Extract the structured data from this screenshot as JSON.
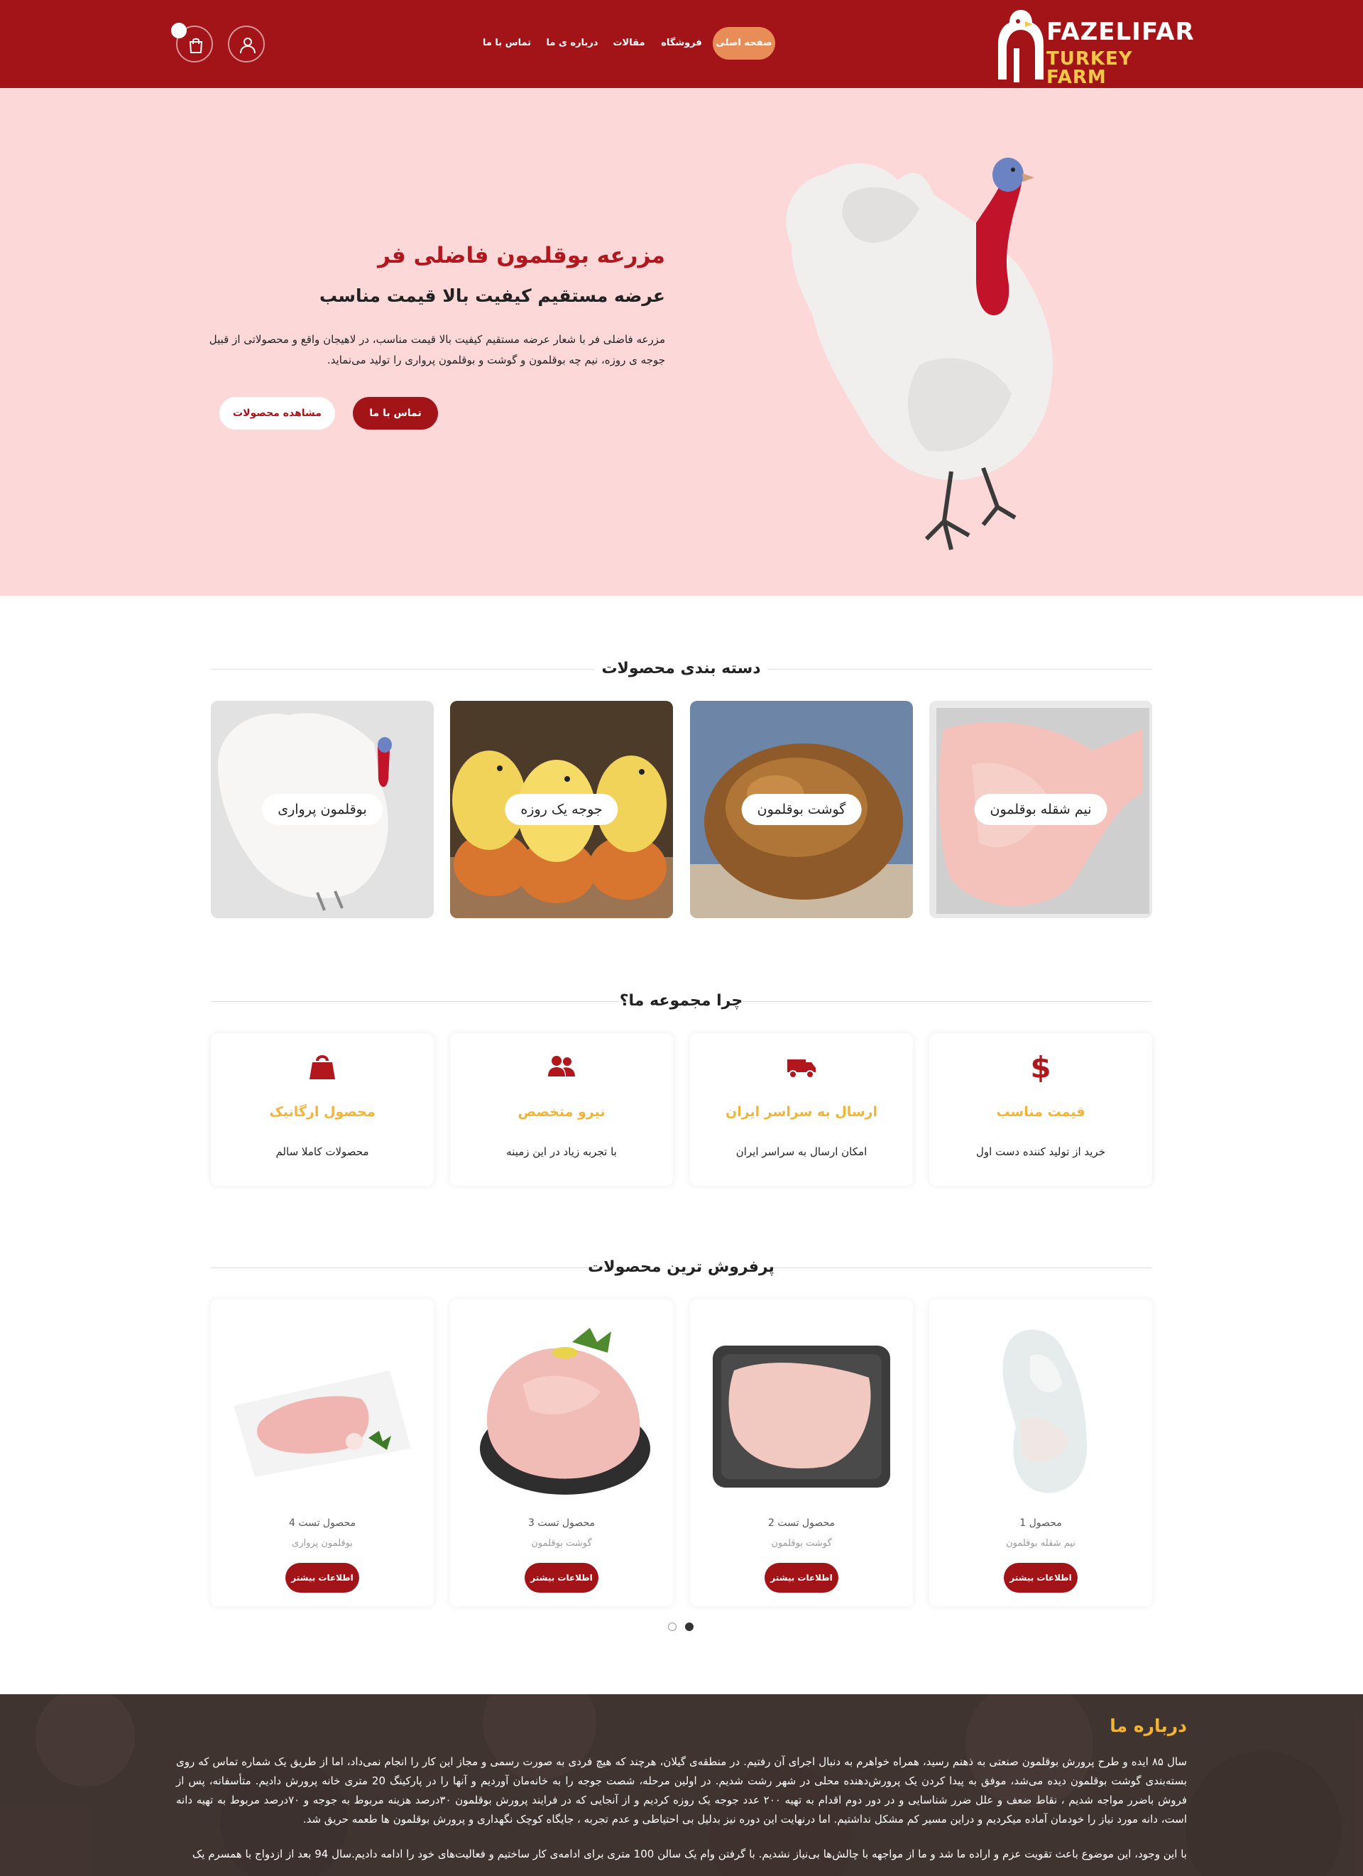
{
  "header": {
    "logo": {
      "line1": "FAZELIFAR",
      "line2": "TURKEY FARM"
    },
    "nav": [
      {
        "label": "صفحه اصلی",
        "active": true
      },
      {
        "label": "فروشگاه",
        "active": false
      },
      {
        "label": "مقالات",
        "active": false
      },
      {
        "label": "درباره ی ما",
        "active": false
      },
      {
        "label": "تماس با ما",
        "active": false
      }
    ],
    "icons": [
      "user-icon",
      "cart-icon"
    ]
  },
  "hero": {
    "title": "مزرعه بوقلمون فاضلی فر",
    "subtitle": "عرضه مستقیم کیفیت بالا قیمت مناسب",
    "description": "مزرعه فاضلی فر با شعار عرضه مستقیم کیفیت بالا قیمت مناسب، در لاهیجان واقع و محصولاتی از قبیل جوجه ی روزه، نیم چه بوقلمون و گوشت و بوقلمون پرواری را تولید می‌نماید.",
    "primary_button": "تماس با ما",
    "secondary_button": "مشاهده محصولات"
  },
  "categories": {
    "title": "دسته بندی محصولات",
    "items": [
      {
        "label": "نیم شقله بوقلمون"
      },
      {
        "label": "گوشت بوقلمون"
      },
      {
        "label": "جوجه یک روزه"
      },
      {
        "label": "بوقلمون پرواری"
      }
    ]
  },
  "features": {
    "title": "چرا مجموعه ما؟",
    "items": [
      {
        "icon": "dollar-icon",
        "title": "قیمت مناسب",
        "desc": "خرید از تولید کننده دست اول"
      },
      {
        "icon": "truck-icon",
        "title": "ارسال به سراسر ایران",
        "desc": "امکان ارسال به سراسر ایران"
      },
      {
        "icon": "users-icon",
        "title": "نیرو متخصص",
        "desc": "با تجربه زیاد در این زمینه"
      },
      {
        "icon": "bag-icon",
        "title": "محصول ارگانیک",
        "desc": "محصولات کاملا سالم"
      }
    ]
  },
  "products": {
    "title": "پرفروش ترین محصولات",
    "button_label": "اطلاعات بیشتر",
    "items": [
      {
        "name": "محصول 1",
        "category": "نیم شقله بوقلمون"
      },
      {
        "name": "محصول تست 2",
        "category": "گوشت بوقلمون"
      },
      {
        "name": "محصول تست 3",
        "category": "گوشت بوقلمون"
      },
      {
        "name": "محصول تست 4",
        "category": "بوقلمون پرواری"
      }
    ],
    "carousel_pages": 2,
    "carousel_active": 1
  },
  "about": {
    "title": "درباره ما",
    "paragraph1": "سال ۸۵ ایده و طرح پرورش بوقلمون صنعتی به ذهنم رسید، همراه خواهرم به دنبال اجرای آن رفتیم. در منطقه‌ی گیلان، هرچند که هیچ فردی به صورت رسمی و مجاز این کار را انجام نمی‌داد، اما از طریق یک شماره تماس که روی بسته‌بندی گوشت بوقلمون دیده می‌شد، موفق به پیدا کردن یک پرورش‌دهنده محلی در شهر رشت شدیم. در اولین مرحله، شصت جوجه را به خانه‌مان آوردیم و آنها را در پارکینگ 20 متری خانه پرورش دادیم. متأسفانه، پس از فروش باضرر مواجه شدیم ، نقاط ضعف و علل ضرر شناسایی و در دور دوم اقدام به تهیه ۲۰۰ عدد جوجه یک روزه کردیم و از آنجایی که در فرایند پرورش بوقلمون ۳۰درصد هزینه مربوط به جوجه و ۷۰درصد مربوط به تهیه دانه است، دانه مورد نیاز را خودمان آماده میکردیم و دراین مسیر کم مشکل نداشتیم. اما درنهایت این دوره نیز بدلیل بی احتیاطی و عدم تجربه ، جایگاه کوچک نگهداری و پرورش بوقلمون ها طعمه حریق شد.",
    "paragraph2": "با این وجود، این موضوع باعث تقویت عزم و اراده ما شد و ما از مواجهه با چالش‌ها بی‌نیاز نشدیم. با گرفتن وام یک سالن 100 متری برای ادامه‌ی کار ساختیم و فعالیت‌های خود را ادامه دادیم.سال 94 بعد از ازدواج با همسرم یک"
  }
}
